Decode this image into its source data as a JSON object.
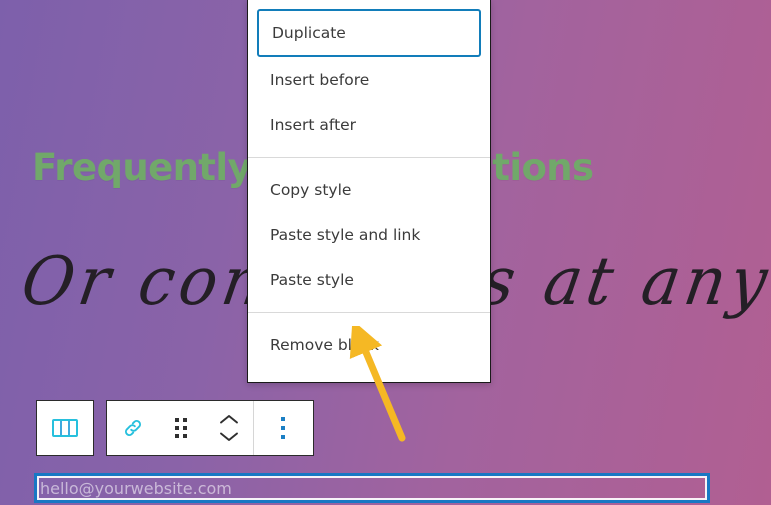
{
  "page": {
    "heading": "Frequently asked questions",
    "script_text": "Or contact us at any",
    "heading_color": "#71a86a",
    "background_gradient_from": "#7d60ab",
    "background_gradient_to": "#b15f92"
  },
  "email_input": {
    "placeholder": "hello@yourwebsite.com",
    "value": "",
    "focus_ring_color": "#1878c4"
  },
  "block_toolbar": {
    "parent_block_button": {
      "label": "Select parent block: Columns",
      "icon": "columns-icon",
      "icon_color": "#27c0dd"
    },
    "items": [
      {
        "label": "Link",
        "icon": "link-icon",
        "icon_color": "#27c0dd"
      },
      {
        "label": "Drag",
        "icon": "drag-handle-icon",
        "icon_color": "#2f2f2f"
      },
      {
        "label": "Move up / Move down",
        "icon": "move-up-down-chevrons-icon",
        "icon_color": "#2f2f2f"
      },
      {
        "label": "Options",
        "icon": "more-vertical-icon",
        "icon_color": "#1b7fc4"
      }
    ]
  },
  "options_menu": {
    "groups": [
      {
        "items": [
          {
            "label": "Duplicate",
            "focused": true
          },
          {
            "label": "Insert before",
            "focused": false
          },
          {
            "label": "Insert after",
            "focused": false
          }
        ]
      },
      {
        "items": [
          {
            "label": "Copy style",
            "focused": false
          },
          {
            "label": "Paste style and link",
            "focused": false
          },
          {
            "label": "Paste style",
            "focused": false
          }
        ]
      },
      {
        "items": [
          {
            "label": "Remove block",
            "focused": false
          }
        ]
      }
    ]
  },
  "annotation": {
    "arrow_color": "#f5b824",
    "points_to": "Remove block"
  }
}
